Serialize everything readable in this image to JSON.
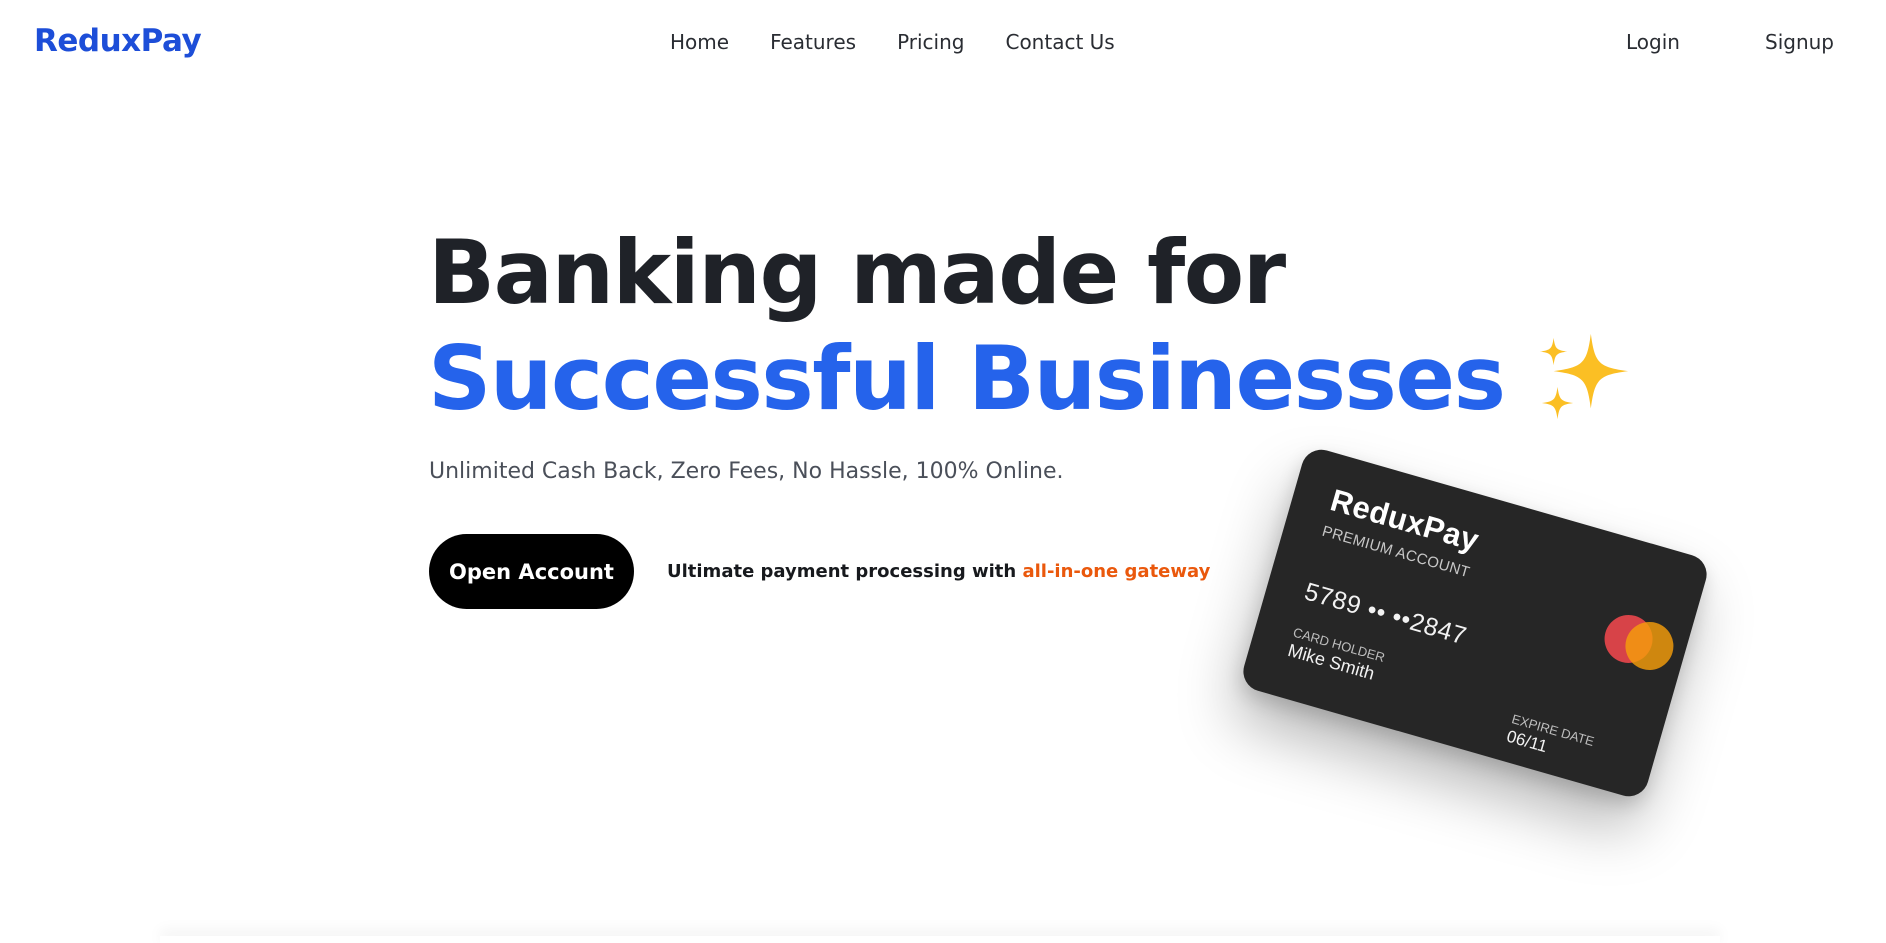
{
  "header": {
    "logo": "ReduxPay",
    "nav": [
      "Home",
      "Features",
      "Pricing",
      "Contact Us"
    ],
    "login": "Login",
    "signup": "Signup"
  },
  "hero": {
    "title_line1": "Banking made for",
    "title_line2": "Successful Businesses",
    "subtitle": "Unlimited Cash Back, Zero Fees, No Hassle, 100% Online.",
    "cta": "Open Account",
    "tagline_prefix": "Ultimate payment processing with ",
    "tagline_accent": "all-in-one gateway",
    "emoji_icon": "sparkles-icon"
  },
  "card": {
    "brand": "ReduxPay",
    "tier": "PREMIUM ACCOUNT",
    "number": "5789 •• ••2847",
    "holder_label": "CARD HOLDER",
    "holder": "Mike Smith",
    "expiry_label": "EXPIRE DATE",
    "expiry": "06/11",
    "network_icon": "mastercard-logo"
  },
  "colors": {
    "brand_blue": "#1d4ed8",
    "headline_blue": "#2563eb",
    "accent_orange": "#ea580c",
    "card_bg": "#262626",
    "cta_bg": "#000000",
    "sparkle_yellow": "#fbbf24"
  }
}
